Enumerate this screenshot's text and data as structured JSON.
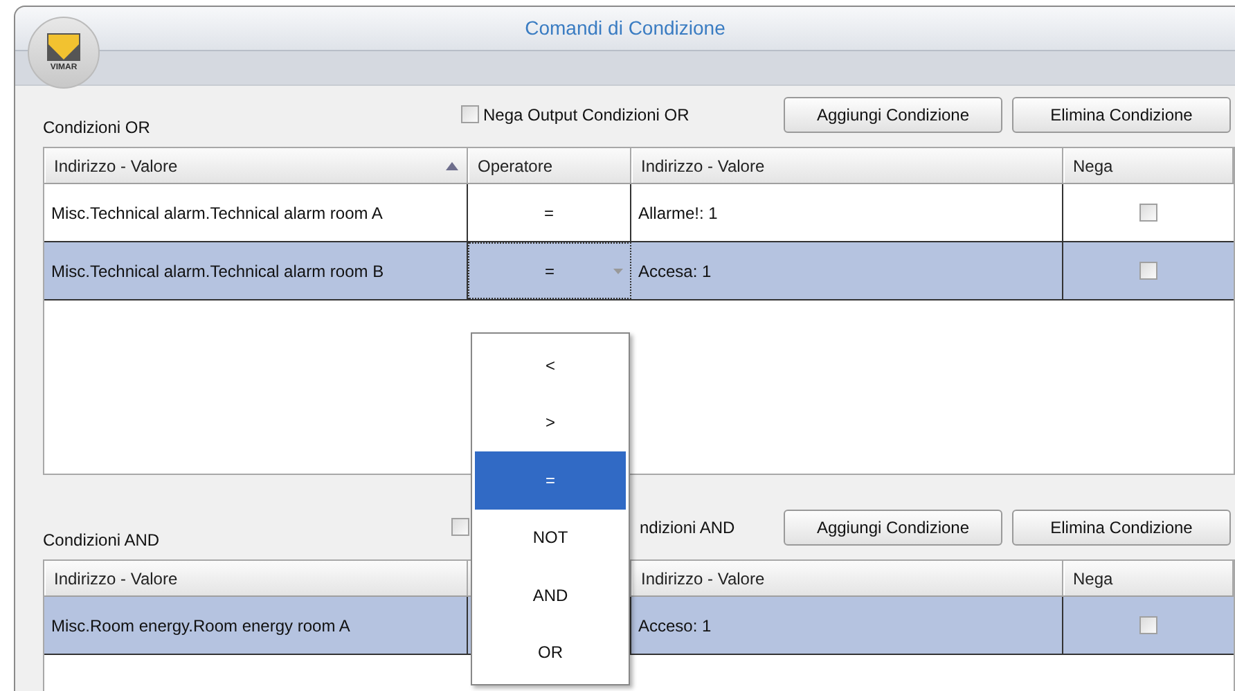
{
  "window": {
    "title": "Comandi di Condizione"
  },
  "logo": {
    "text": "VIMAR"
  },
  "or_section": {
    "label": "Condizioni OR",
    "negate_output": {
      "label": "Nega Output Condizioni OR",
      "checked": false
    },
    "buttons": [
      "Aggiungi Condizione",
      "Elimina Condizione"
    ],
    "table": {
      "columns": [
        {
          "label": "Indirizzo - Valore",
          "sorted": true
        },
        {
          "label": "Operatore",
          "sorted": false
        },
        {
          "label": "Indirizzo - Valore",
          "sorted": false
        },
        {
          "label": "Nega",
          "sorted": false
        }
      ],
      "rows": [
        {
          "address": "Misc.Technical alarm.Technical alarm room A",
          "operator": "=",
          "value": "Allarme!: 1",
          "negate": false,
          "selected": false,
          "editing": false
        },
        {
          "address": "Misc.Technical alarm.Technical alarm room B",
          "operator": "=",
          "value": "Accesa: 1",
          "negate": false,
          "selected": true,
          "editing": true
        }
      ]
    }
  },
  "and_section": {
    "label": "Condizioni AND",
    "negate_output": {
      "label": "ndizioni AND",
      "checked": false
    },
    "buttons": [
      "Aggiungi Condizione",
      "Elimina Condizione"
    ],
    "table": {
      "columns": [
        {
          "label": "Indirizzo - Valore",
          "sorted": false
        },
        {
          "label": "Indirizzo - Valore",
          "sorted": false
        },
        {
          "label": "Nega",
          "sorted": false
        }
      ],
      "rows": [
        {
          "address": "Misc.Room energy.Room energy room A",
          "value": "Acceso: 1",
          "negate": false,
          "selected": true
        }
      ]
    }
  },
  "operator_dropdown": {
    "items": [
      {
        "label": "<",
        "selected": false
      },
      {
        "label": ">",
        "selected": false
      },
      {
        "label": "=",
        "selected": true
      },
      {
        "label": "NOT",
        "selected": false
      },
      {
        "label": "AND",
        "selected": false
      },
      {
        "label": "OR",
        "selected": false
      }
    ]
  }
}
